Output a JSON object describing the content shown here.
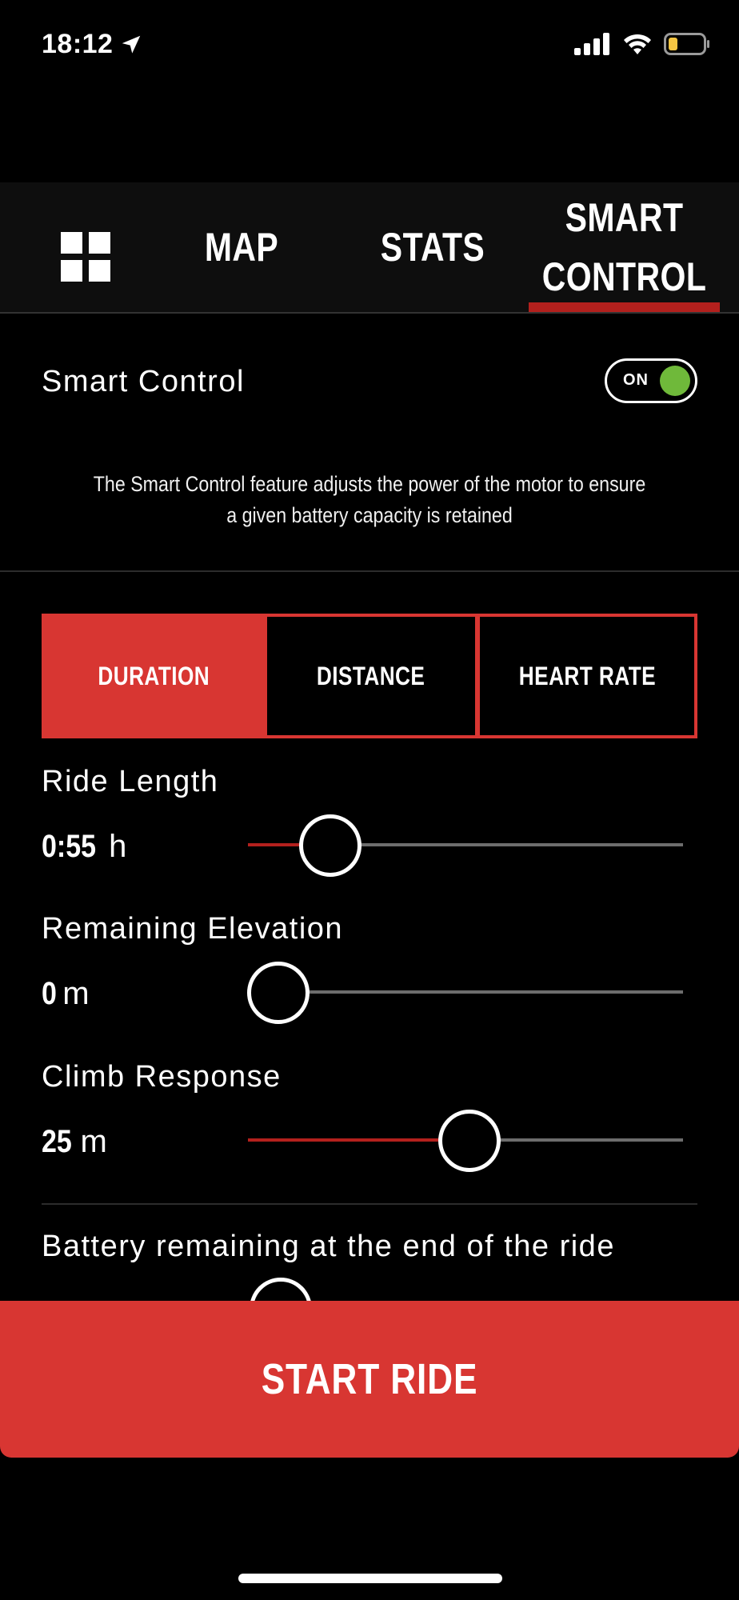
{
  "status_bar": {
    "time": "18:12",
    "icons": [
      "location-arrow-icon",
      "cellular-signal-icon",
      "wifi-icon",
      "battery-low-icon"
    ]
  },
  "tabs": [
    {
      "label": "",
      "icon": "grid-icon",
      "active": false
    },
    {
      "label": "MAP",
      "active": false
    },
    {
      "label": "STATS",
      "active": false
    },
    {
      "label": "SMART\nCONTROL",
      "active": true
    }
  ],
  "smart_control": {
    "label": "Smart Control",
    "toggle_label": "ON",
    "toggle_on": true,
    "description": "The Smart Control feature adjusts the power of the motor to ensure a given battery capacity is retained"
  },
  "modes": [
    {
      "label": "DURATION",
      "active": true
    },
    {
      "label": "DISTANCE",
      "active": false
    },
    {
      "label": "HEART RATE",
      "active": false
    }
  ],
  "sliders": {
    "ride_length": {
      "label": "Ride Length",
      "value": "0:55",
      "unit": "h",
      "level": 0.19
    },
    "remaining_elevation": {
      "label": "Remaining Elevation",
      "value": "0",
      "unit": "m",
      "level": 0.07
    },
    "climb_response": {
      "label": "Climb Response",
      "value": "25",
      "unit": "m",
      "level": 0.51
    },
    "battery_remaining": {
      "label": "Battery remaining at the end of the ride"
    }
  },
  "start_button": {
    "label": "START RIDE"
  },
  "colors": {
    "accent": "#d83632",
    "track_fill": "#b3201d",
    "toggle_on": "#6fb93a",
    "background": "#000000"
  }
}
